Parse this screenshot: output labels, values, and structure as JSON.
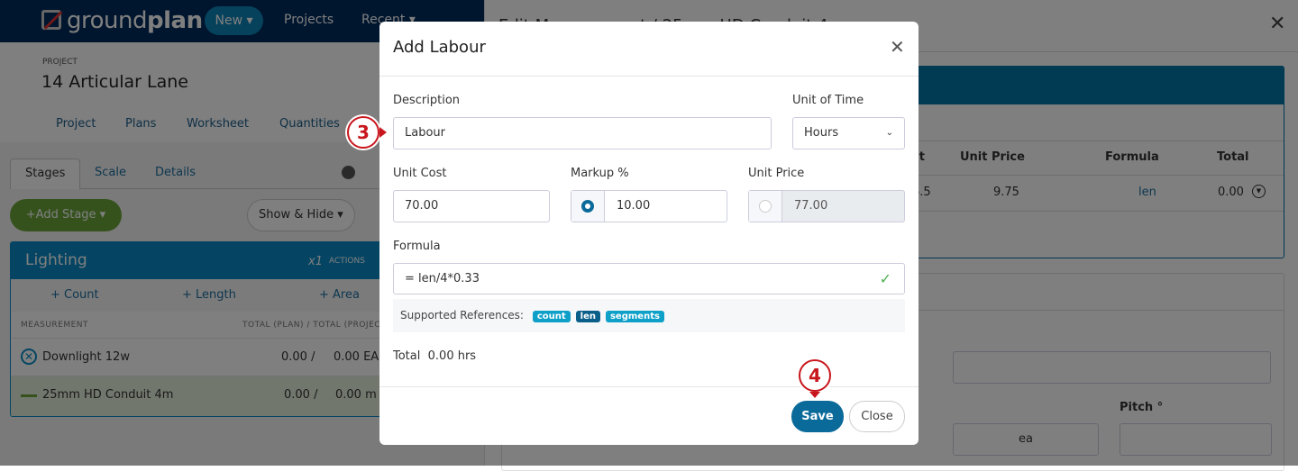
{
  "nav": {
    "brand_light": "ground",
    "brand_bold": "plan",
    "new_label": "New ▾",
    "projects_label": "Projects",
    "recent_label": "Recent ▾"
  },
  "project": {
    "label": "PROJECT",
    "title": "14 Articular Lane"
  },
  "tabs": [
    "Project",
    "Plans",
    "Worksheet",
    "Quantities"
  ],
  "subtabs": [
    "Stages",
    "Scale",
    "Details"
  ],
  "toolbar": {
    "add_stage": "+Add Stage ▾",
    "show_hide": "Show & Hide ▾"
  },
  "stage": {
    "title": "Lighting",
    "multiplier": "x1",
    "actions": "ACTIONS",
    "add_count": "+ Count",
    "add_length": "+ Length",
    "add_area": "+ Area",
    "col_measurement": "MEASUREMENT",
    "col_total": "TOTAL (PLAN) / TOTAL (PROJECT)",
    "rows": [
      {
        "name": "Downlight 12w",
        "plan": "0.00 /",
        "project": "0.00 EA",
        "icon": "count-icon"
      },
      {
        "name": "25mm HD Conduit 4m",
        "plan": "0.00 /",
        "project": "0.00 m",
        "icon": "length-icon"
      }
    ]
  },
  "side": {
    "title": "Edit Measurement / 25mm HD Conduit 4m",
    "cols": [
      "st",
      "Unit Price",
      "Formula",
      "Total"
    ],
    "row": [
      "6.5",
      "9.75",
      "len",
      "0.00"
    ],
    "unit_cell": "ea",
    "pitch_label": "Pitch °"
  },
  "modal": {
    "title": "Add Labour",
    "description_label": "Description",
    "description_value": "Labour",
    "unit_time_label": "Unit of Time",
    "unit_time_value": "Hours",
    "unit_cost_label": "Unit Cost",
    "unit_cost_value": "70.00",
    "markup_label": "Markup %",
    "markup_value": "10.00",
    "unit_price_label": "Unit Price",
    "unit_price_value": "77.00",
    "formula_label": "Formula",
    "formula_value": "= len/4*0.33",
    "refs_label": "Supported References:",
    "refs": [
      "count",
      "len",
      "segments"
    ],
    "total_label": "Total",
    "total_value": "0.00 hrs",
    "save": "Save",
    "close": "Close"
  },
  "callouts": [
    "3",
    "4"
  ],
  "colors": {
    "nav": "#002b5c",
    "accent": "#0a6a9a",
    "green": "#6ba53a",
    "callout": "#c8161d"
  }
}
